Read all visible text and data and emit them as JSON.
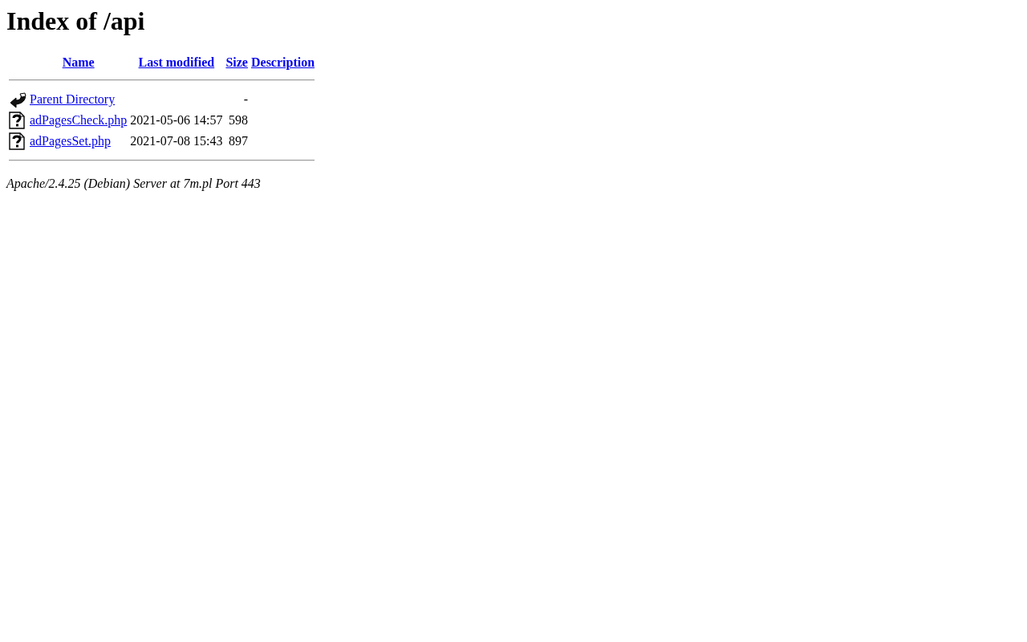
{
  "title": "Index of /api",
  "table": {
    "columns": [
      "Name",
      "Last modified",
      "Size",
      "Description"
    ],
    "rows": [
      {
        "kind": "parent",
        "name": "Parent Directory",
        "last_modified": "",
        "size": "-"
      },
      {
        "kind": "unknown",
        "name": "adPagesCheck.php",
        "last_modified": "2021-05-06 14:57",
        "size": "598"
      },
      {
        "kind": "unknown",
        "name": "adPagesSet.php",
        "last_modified": "2021-07-08 15:43",
        "size": "897"
      }
    ]
  },
  "footer": "Apache/2.4.25 (Debian) Server at 7m.pl Port 443"
}
